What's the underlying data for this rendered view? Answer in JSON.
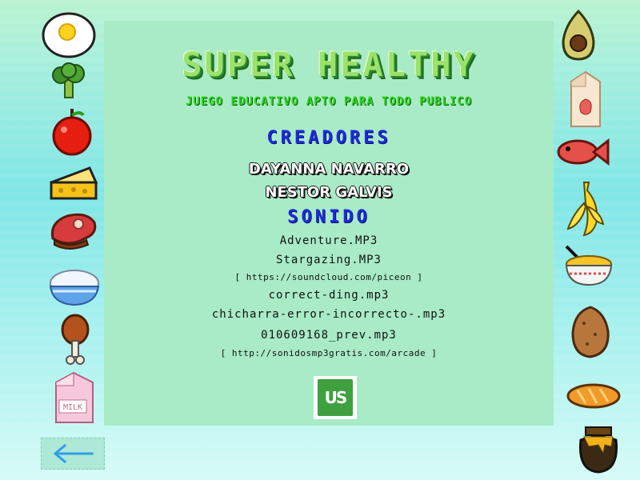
{
  "game": {
    "title": "SUPER HEALTHY",
    "subtitle": "JUEGO EDUCATIVO APTO PARA TODO PUBLICO"
  },
  "credits": {
    "creators_heading": "CREADORES",
    "creators": [
      "DAYANNA NAVARRO",
      "NESTOR GALVIS"
    ],
    "sound_heading": "SONIDO",
    "sound_lines": [
      "Adventure.MP3",
      "Stargazing.MP3",
      "[ https://soundcloud.com/piceon ]",
      "correct-ding.mp3",
      "chicharra-error-incorrecto-.mp3",
      "010609168_prev.mp3",
      "[ http://sonidosmp3gratis.com/arcade ]"
    ]
  },
  "logo": {
    "text": "US"
  },
  "back_button": {
    "icon": "left-arrow-icon"
  },
  "left_foods": [
    "fried-egg-icon",
    "broccoli-icon",
    "tomato-icon",
    "cheese-icon",
    "steak-icon",
    "rice-bowl-icon",
    "chicken-leg-icon",
    "milk-carton-icon"
  ],
  "right_foods": [
    "avocado-icon",
    "strawberry-milk-icon",
    "fish-icon",
    "banana-icon",
    "noodle-bowl-icon",
    "potato-icon",
    "bread-icon",
    "honey-pot-icon"
  ],
  "colors": {
    "panel": "#a8ebc6",
    "title_green": "#9be26b",
    "subtitle_green": "#2fd71f",
    "heading_blue": "#1d2bd8"
  }
}
